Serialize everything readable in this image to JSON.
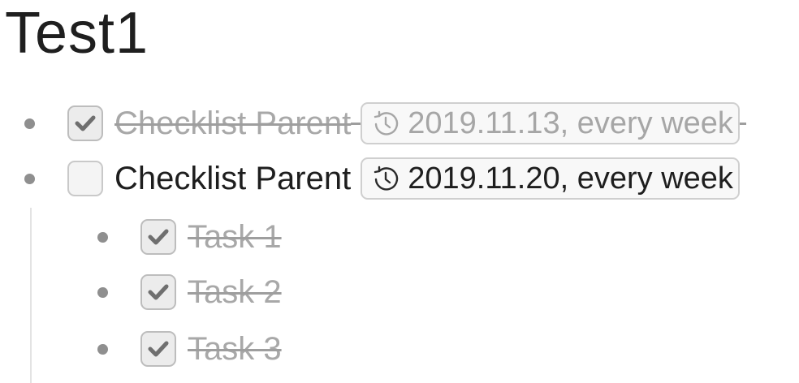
{
  "page": {
    "title": "Test1"
  },
  "items": [
    {
      "label": "Checklist Parent",
      "checked": true,
      "date_chip": {
        "icon": "clock-repeat-icon",
        "text": "2019.11.13, every week"
      }
    },
    {
      "label": "Checklist Parent",
      "checked": false,
      "date_chip": {
        "icon": "clock-repeat-icon",
        "text": "2019.11.20, every week"
      },
      "children": [
        {
          "label": "Task 1",
          "checked": true
        },
        {
          "label": "Task 2",
          "checked": true
        },
        {
          "label": "Task 3",
          "checked": true
        }
      ]
    }
  ],
  "colors": {
    "text": "#1e1e1e",
    "done_text": "#a8a8a8",
    "bullet": "#8f8f8f",
    "chip_border": "#cfcfcf"
  }
}
